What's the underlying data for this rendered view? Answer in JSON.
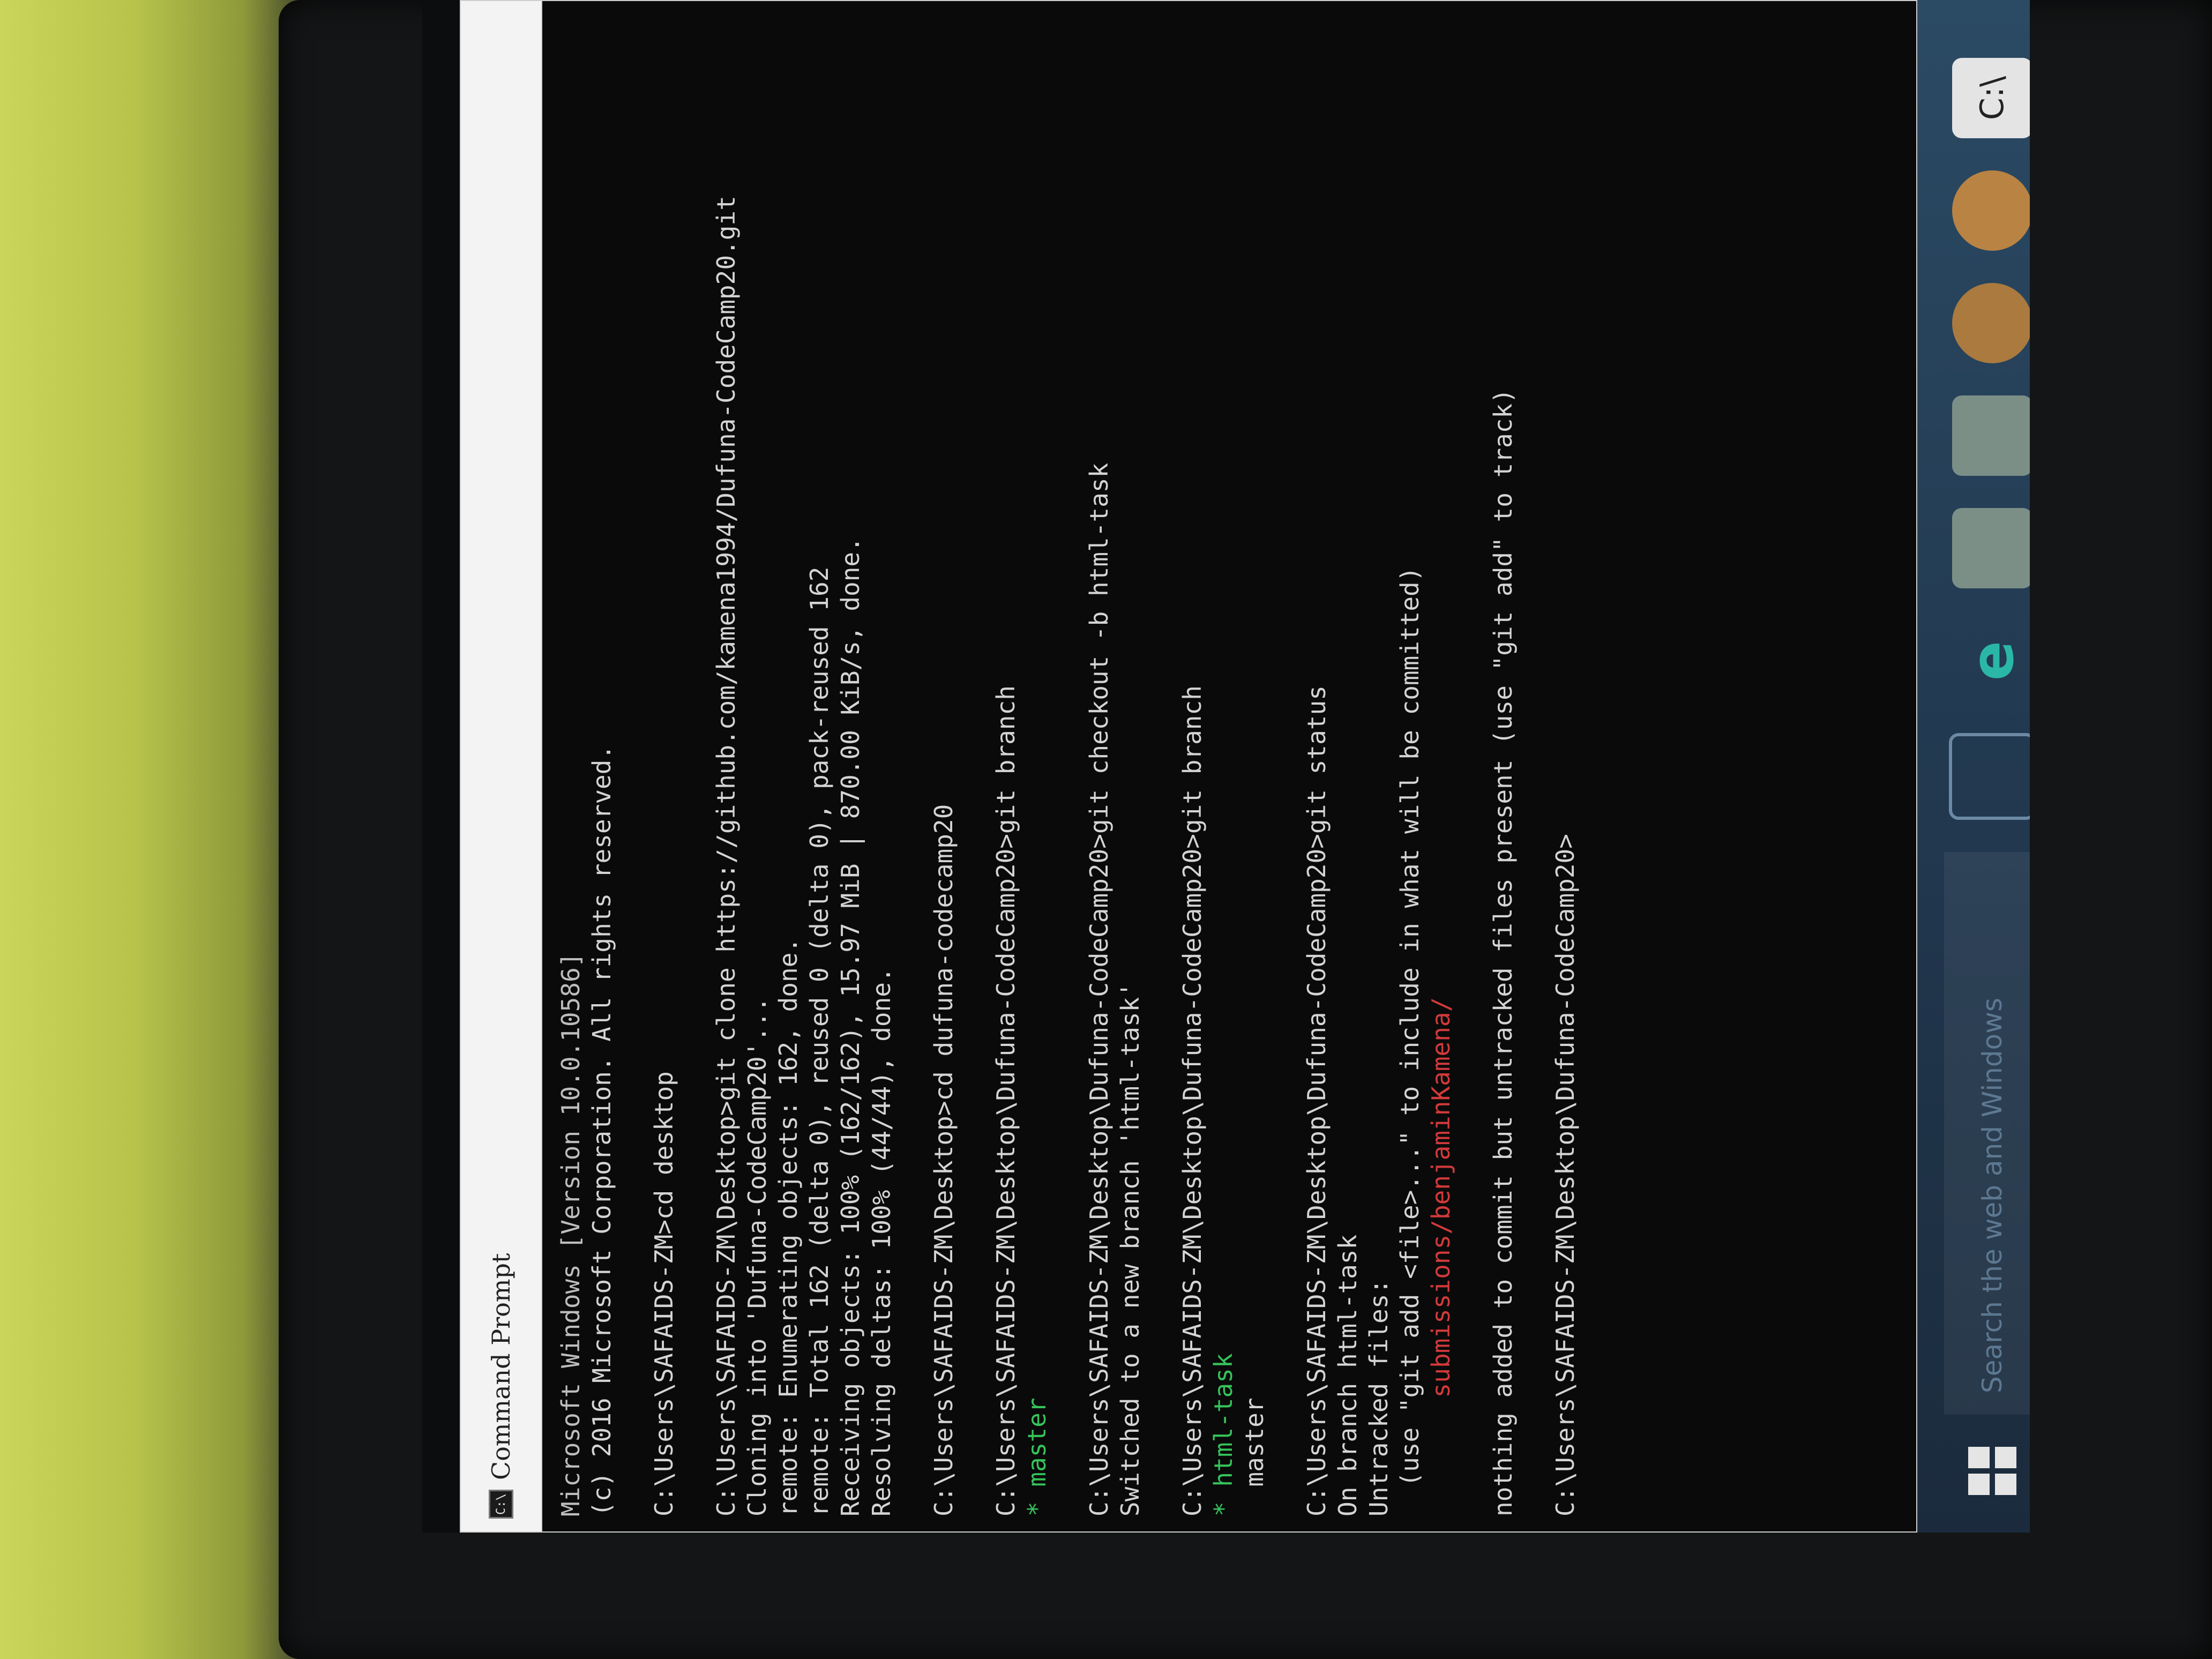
{
  "window": {
    "title": "Command Prompt",
    "icon": "cmd-icon",
    "icon_text": "C:\\"
  },
  "console_lines": [
    {
      "text": "Microsoft Windows [Version 10.0.10586]",
      "style": "dim"
    },
    {
      "text": "(c) 2016 Microsoft Corporation. All rights reserved.",
      "style": ""
    },
    {
      "text": "",
      "style": ""
    },
    {
      "text": "C:\\Users\\SAFAIDS-ZM>cd desktop",
      "style": ""
    },
    {
      "text": "",
      "style": ""
    },
    {
      "text": "C:\\Users\\SAFAIDS-ZM\\Desktop>git clone https://github.com/kamena1994/Dufuna-CodeCamp20.git",
      "style": ""
    },
    {
      "text": "Cloning into 'Dufuna-CodeCamp20'...",
      "style": ""
    },
    {
      "text": "remote: Enumerating objects: 162, done.",
      "style": ""
    },
    {
      "text": "remote: Total 162 (delta 0), reused 0 (delta 0), pack-reused 162",
      "style": ""
    },
    {
      "text": "Receiving objects: 100% (162/162), 15.97 MiB | 870.00 KiB/s, done.",
      "style": ""
    },
    {
      "text": "Resolving deltas: 100% (44/44), done.",
      "style": ""
    },
    {
      "text": "",
      "style": ""
    },
    {
      "text": "C:\\Users\\SAFAIDS-ZM\\Desktop>cd dufuna-codecamp20",
      "style": ""
    },
    {
      "text": "",
      "style": ""
    },
    {
      "text": "C:\\Users\\SAFAIDS-ZM\\Desktop\\Dufuna-CodeCamp20>git branch",
      "style": ""
    },
    {
      "text": "* master",
      "style": "green"
    },
    {
      "text": "",
      "style": ""
    },
    {
      "text": "C:\\Users\\SAFAIDS-ZM\\Desktop\\Dufuna-CodeCamp20>git checkout -b html-task",
      "style": ""
    },
    {
      "text": "Switched to a new branch 'html-task'",
      "style": ""
    },
    {
      "text": "",
      "style": ""
    },
    {
      "text": "C:\\Users\\SAFAIDS-ZM\\Desktop\\Dufuna-CodeCamp20>git branch",
      "style": ""
    },
    {
      "text": "* html-task",
      "style": "green"
    },
    {
      "text": "  master",
      "style": ""
    },
    {
      "text": "",
      "style": ""
    },
    {
      "text": "C:\\Users\\SAFAIDS-ZM\\Desktop\\Dufuna-CodeCamp20>git status",
      "style": ""
    },
    {
      "text": "On branch html-task",
      "style": ""
    },
    {
      "text": "Untracked files:",
      "style": ""
    },
    {
      "text": "  (use \"git add <file>...\" to include in what will be committed)",
      "style": ""
    },
    {
      "text": "        submissions/benjaminKamena/",
      "style": "red"
    },
    {
      "text": "",
      "style": ""
    },
    {
      "text": "nothing added to commit but untracked files present (use \"git add\" to track)",
      "style": ""
    },
    {
      "text": "",
      "style": ""
    },
    {
      "text": "C:\\Users\\SAFAIDS-ZM\\Desktop\\Dufuna-CodeCamp20>",
      "style": ""
    }
  ],
  "taskbar": {
    "search_placeholder": "Search the web and Windows",
    "icons": [
      "windows-start-icon",
      "task-view-icon",
      "edge-icon",
      "file-explorer-icon",
      "store-icon",
      "app-icon-1",
      "app-icon-2",
      "command-prompt-icon"
    ],
    "edge_glyph": "e",
    "cmd_glyph": "C:\\"
  }
}
